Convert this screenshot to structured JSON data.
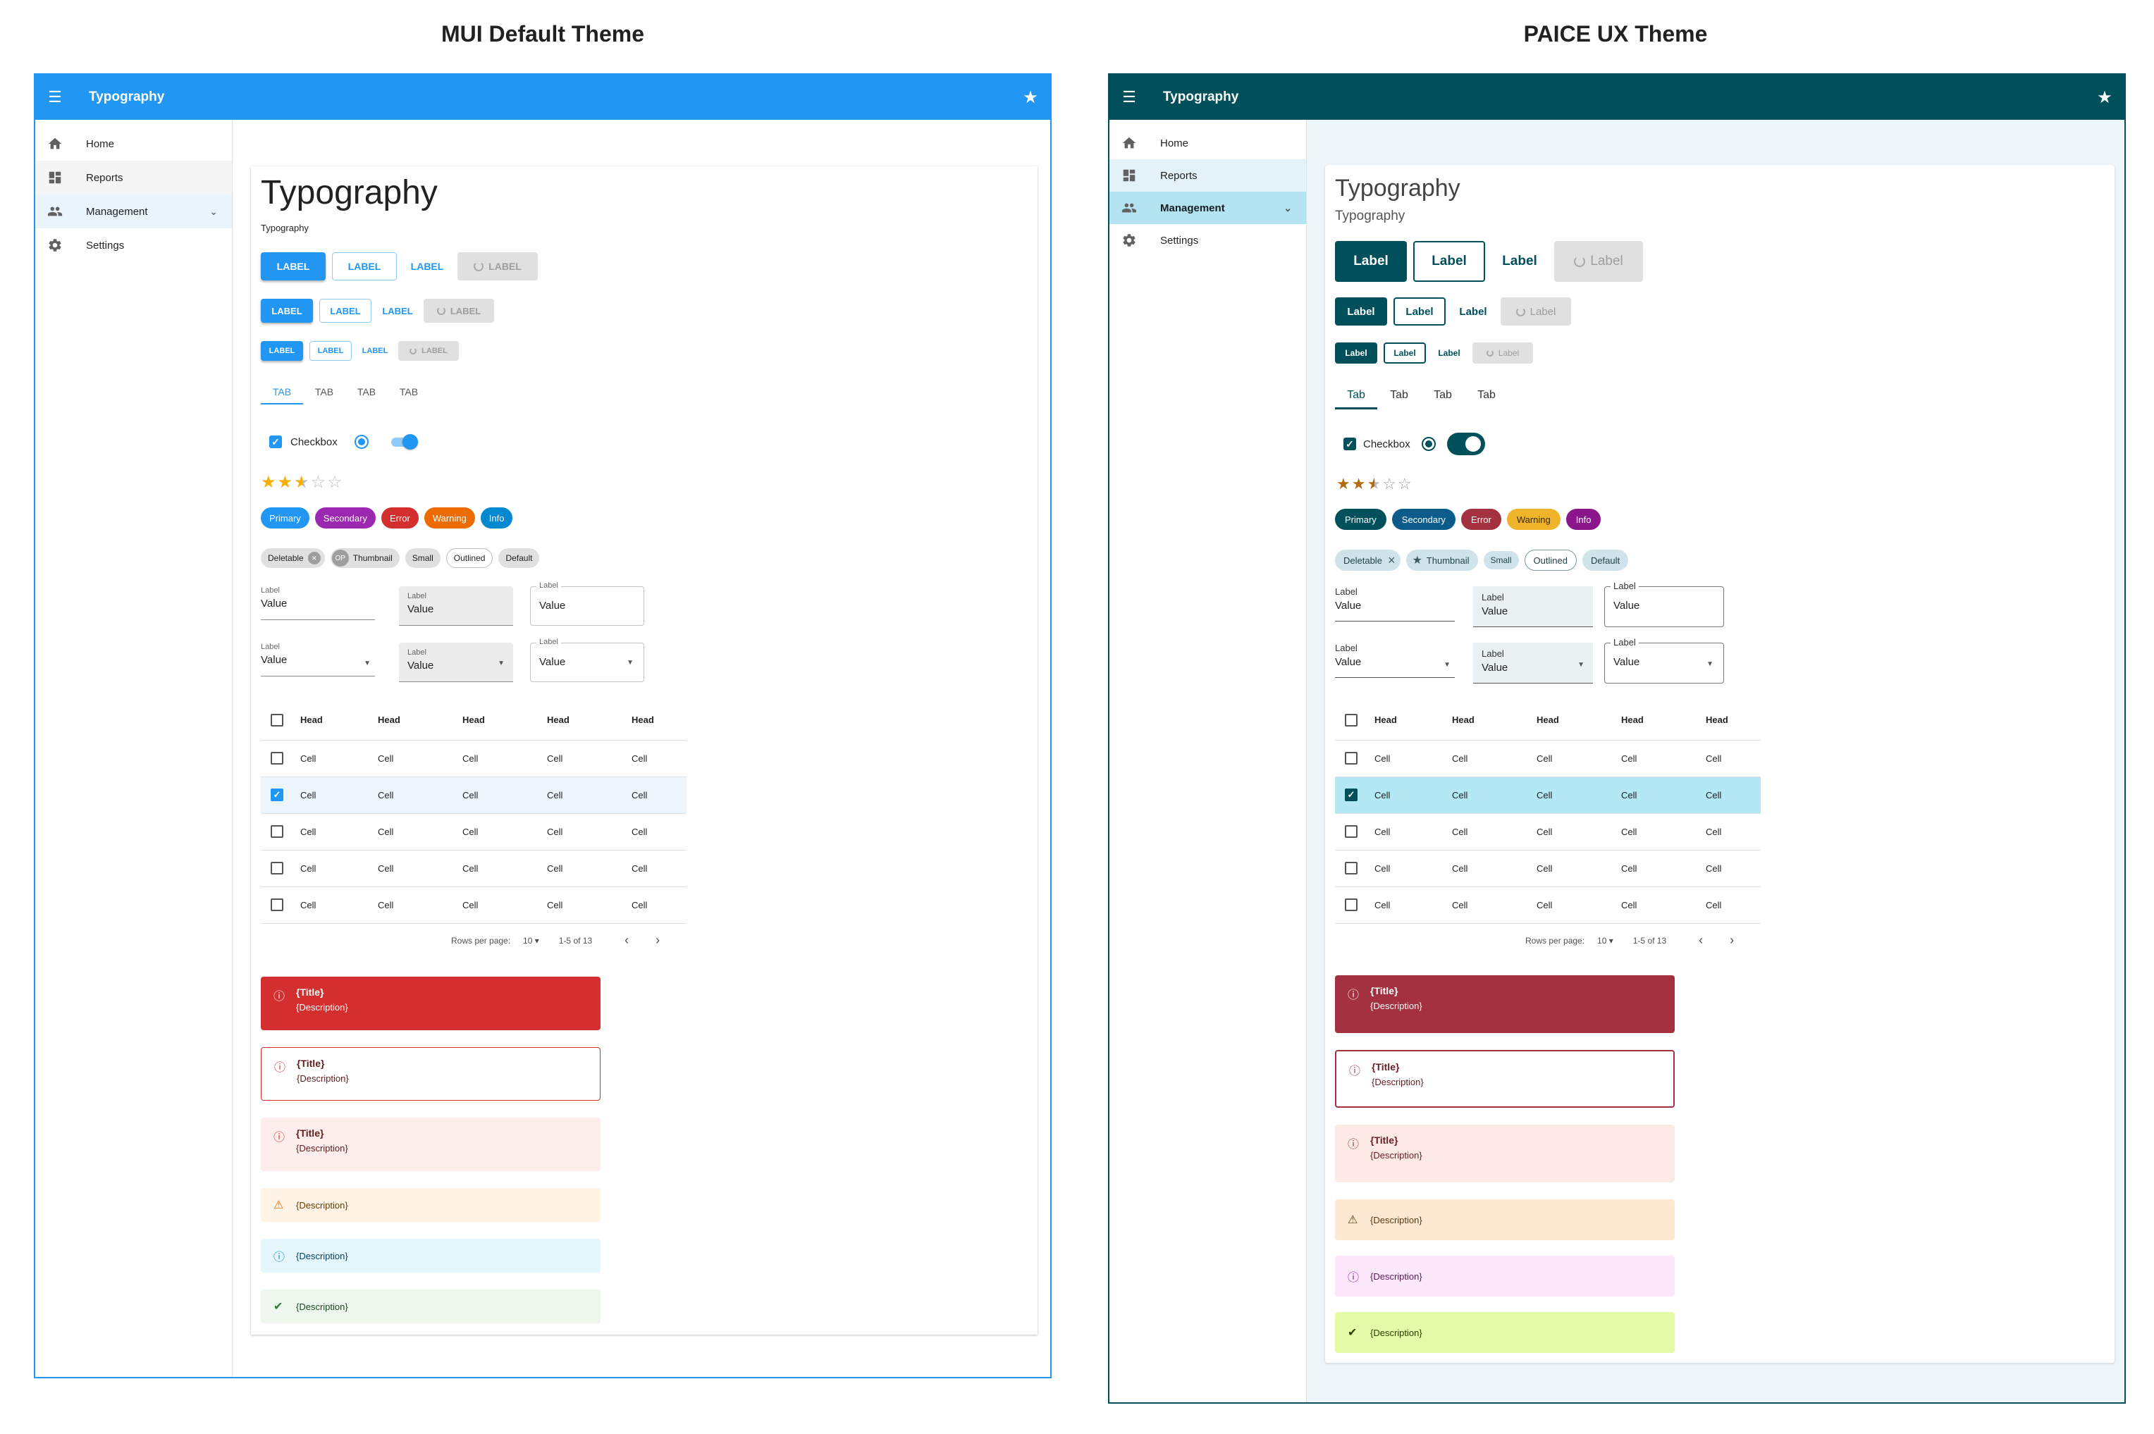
{
  "captions": {
    "left": "MUI Default Theme",
    "right": "PAICE UX Theme"
  },
  "colors": {
    "mui_primary": "#2196f3",
    "mui_secondary": "#9c27b0",
    "mui_error": "#d32f2f",
    "mui_warning": "#ed6c02",
    "mui_info": "#0288d1",
    "paice_primary": "#00505c",
    "paice_secondary": "#0b5c8a",
    "paice_error": "#a3313f",
    "paice_warning": "#f0b42a",
    "paice_info": "#8b168b"
  },
  "app": {
    "title": "Typography",
    "menu_icon": "menu-icon",
    "star_icon": "star-icon"
  },
  "nav": {
    "items": [
      {
        "label": "Home",
        "icon": "home-icon"
      },
      {
        "label": "Reports",
        "icon": "dashboard-icon"
      },
      {
        "label": "Management",
        "icon": "people-icon"
      },
      {
        "label": "Settings",
        "icon": "gear-icon"
      }
    ]
  },
  "page": {
    "title": "Typography",
    "subtitle": "Typography"
  },
  "mui": {
    "button_label": "LABEL",
    "tab_label": "TAB"
  },
  "paice": {
    "button_label": "Label",
    "tab_label": "Tab"
  },
  "controls": {
    "checkbox_label": "Checkbox"
  },
  "rating": {
    "value": 2.5,
    "max": 5
  },
  "chips_colored": [
    "Primary",
    "Secondary",
    "Error",
    "Warning",
    "Info"
  ],
  "chips_default": {
    "deletable": "Deletable",
    "avatar_initials": "OP",
    "thumbnail": "Thumbnail",
    "small": "Small",
    "outlined": "Outlined",
    "default": "Default"
  },
  "fields": {
    "label": "Value",
    "caption": "Label",
    "value": "Value"
  },
  "table": {
    "head": [
      "Head",
      "Head",
      "Head",
      "Head",
      "Head"
    ],
    "rows": [
      {
        "cells": [
          "Cell",
          "Cell",
          "Cell",
          "Cell",
          "Cell"
        ],
        "checked": false
      },
      {
        "cells": [
          "Cell",
          "Cell",
          "Cell",
          "Cell",
          "Cell"
        ],
        "checked": true
      },
      {
        "cells": [
          "Cell",
          "Cell",
          "Cell",
          "Cell",
          "Cell"
        ],
        "checked": false
      },
      {
        "cells": [
          "Cell",
          "Cell",
          "Cell",
          "Cell",
          "Cell"
        ],
        "checked": false
      },
      {
        "cells": [
          "Cell",
          "Cell",
          "Cell",
          "Cell",
          "Cell"
        ],
        "checked": false
      }
    ],
    "rows_per_page_label": "Rows per page:",
    "rows_per_page": "10",
    "range": "1-5 of 13"
  },
  "alerts": {
    "title": "{Title}",
    "description": "{Description}"
  }
}
